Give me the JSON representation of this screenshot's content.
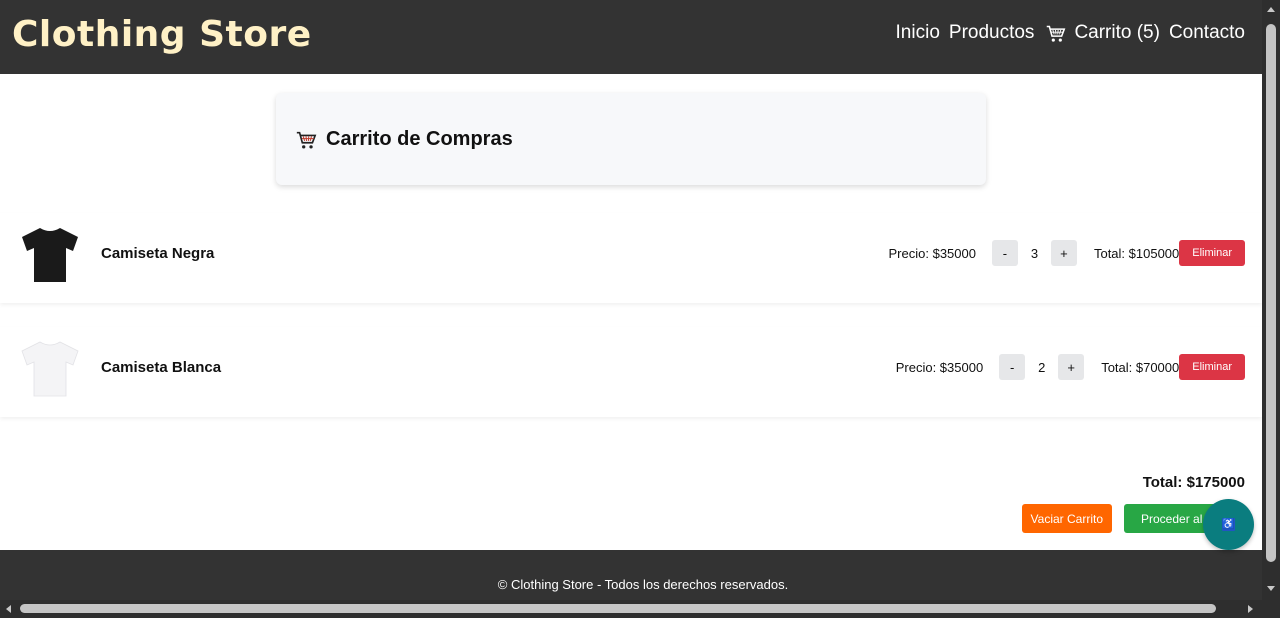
{
  "header": {
    "logo": "Clothing Store",
    "nav": {
      "inicio": "Inicio",
      "productos": "Productos",
      "carrito": "Carrito (5)",
      "contacto": "Contacto"
    }
  },
  "cart": {
    "title": "Carrito de Compras",
    "items": [
      {
        "name": "Camiseta Negra",
        "price": "Precio: $35000",
        "minus": "-",
        "quantity": "3",
        "plus": "+",
        "total": "Total: $105000",
        "remove": "Eliminar",
        "shirt_color": "#1a1a1a"
      },
      {
        "name": "Camiseta Blanca",
        "price": "Precio: $35000",
        "minus": "-",
        "quantity": "2",
        "plus": "+",
        "total": "Total: $70000",
        "remove": "Eliminar",
        "shirt_color": "#f4f4f6"
      }
    ],
    "grand_total": "Total: $175000",
    "empty_button": "Vaciar Carrito",
    "checkout_button": "Proceder al Pago"
  },
  "footer": {
    "text": "© Clothing Store - Todos los derechos reservados."
  },
  "accessibility": {
    "icon": "accessibility-icon",
    "glyph": "♿"
  },
  "colors": {
    "header_bg": "#333333",
    "logo": "#fff1c6",
    "remove": "#dc3545",
    "empty": "#ff6600",
    "checkout": "#28a745",
    "a11y": "#0a7d7f"
  }
}
